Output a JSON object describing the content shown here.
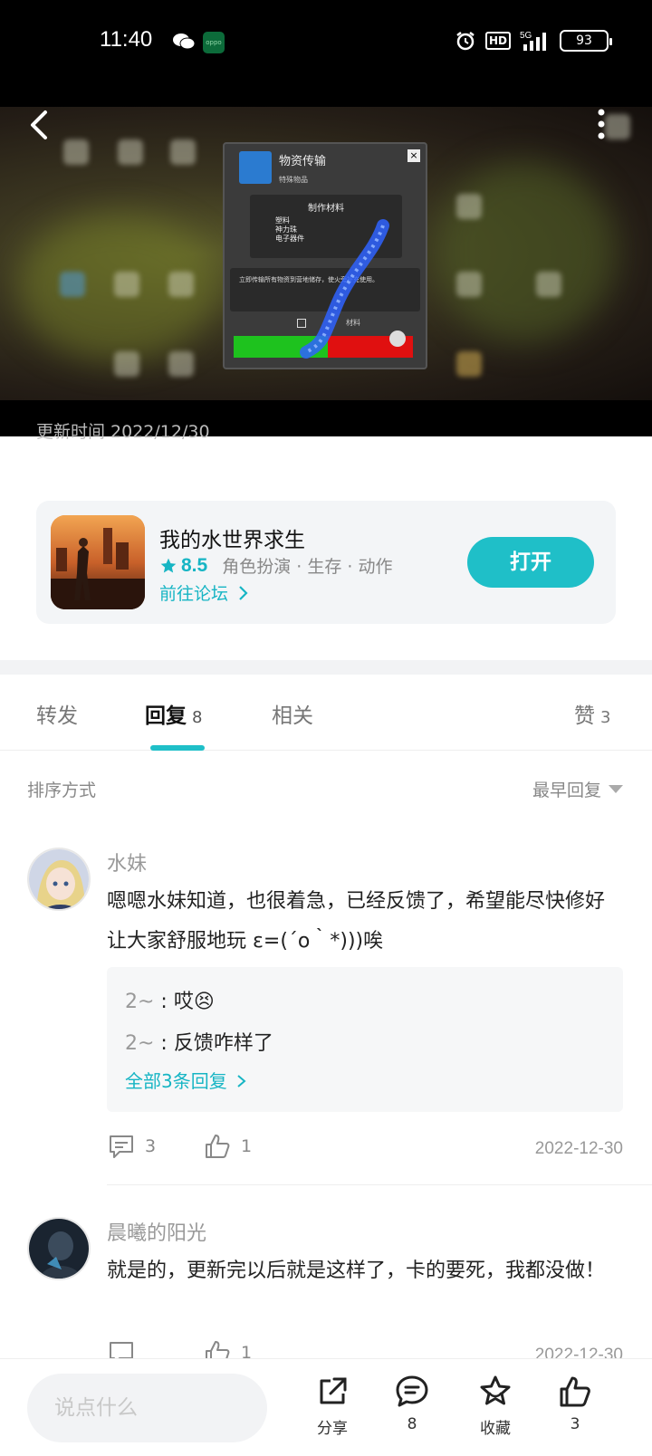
{
  "status_bar": {
    "time": "11:40",
    "oppo_label": "oppo",
    "hd_label": "HD",
    "network": "5G",
    "battery": "93"
  },
  "media": {
    "dialog_title": "物资传输",
    "dialog_subtitle": "特殊物品",
    "materials_title": "制作材料",
    "materials": [
      "塑料",
      "神力珠",
      "电子器件"
    ],
    "description": "立即传输所有物资到营地储存，使火旁补充使用。",
    "checkbox_label": "材料"
  },
  "post": {
    "update_time": "更新时间 2022/12/30"
  },
  "game": {
    "name": "我的水世界求生",
    "rating": "8.5",
    "tags": "角色扮演 · 生存 · 动作",
    "forum_link": "前往论坛",
    "open_label": "打开"
  },
  "tabs": {
    "forward": "转发",
    "reply": "回复",
    "reply_count": "8",
    "related": "相关",
    "like": "赞",
    "like_count": "3"
  },
  "sort": {
    "label": "排序方式",
    "value": "最早回复"
  },
  "comments": [
    {
      "user": "水妹",
      "text": "嗯嗯水妹知道，也很着急，已经反馈了，希望能尽快修好让大家舒服地玩 ε=(´ο｀*)))唉",
      "replies": [
        {
          "user": "2~",
          "text": "哎😣"
        },
        {
          "user": "2~",
          "text": "反馈咋样了"
        }
      ],
      "all_replies": "全部3条回复",
      "reply_count": "3",
      "like_count": "1",
      "date": "2022-12-30"
    },
    {
      "user": "晨曦的阳光",
      "text": "就是的，更新完以后就是这样了，卡的要死，我都没做！",
      "reply_count": "",
      "like_count": "1",
      "date": "2022-12-30"
    }
  ],
  "bottom_bar": {
    "input_placeholder": "说点什么",
    "share_label": "分享",
    "comment_count": "8",
    "favorite_label": "收藏",
    "like_count": "3"
  },
  "colors": {
    "accent": "#1fbfc8",
    "link": "#17b5c4"
  }
}
